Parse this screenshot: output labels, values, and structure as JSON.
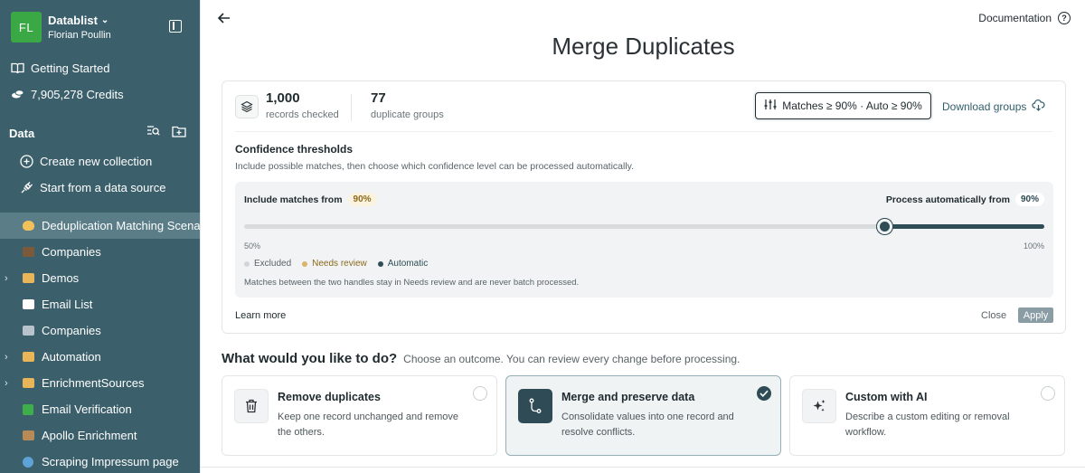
{
  "workspace": {
    "initials": "FL",
    "name": "Datablist",
    "user": "Florian Poullin"
  },
  "sidebar": {
    "getting_started": "Getting Started",
    "credits": "7,905,278 Credits",
    "data_label": "Data",
    "actions": {
      "create": "Create new collection",
      "start": "Start from a data source"
    },
    "collections": [
      {
        "label": "Deduplication Matching Scenarios",
        "icon": "wave-emoji",
        "caret": false,
        "active": true
      },
      {
        "label": "Companies",
        "icon": "briefcase-emoji",
        "caret": false,
        "active": false
      },
      {
        "label": "Demos",
        "icon": "folder-emoji",
        "caret": true,
        "active": false
      },
      {
        "label": "Email List",
        "icon": "email-emoji",
        "caret": false,
        "active": false
      },
      {
        "label": "Companies",
        "icon": "building-emoji",
        "caret": false,
        "active": false
      },
      {
        "label": "Automation",
        "icon": "folder-emoji",
        "caret": true,
        "active": false
      },
      {
        "label": "EnrichmentSources",
        "icon": "folder-emoji",
        "caret": true,
        "active": false
      },
      {
        "label": "Email Verification",
        "icon": "check-emoji",
        "caret": false,
        "active": false
      },
      {
        "label": "Apollo Enrichment",
        "icon": "spy-emoji",
        "caret": false,
        "active": false
      },
      {
        "label": "Scraping Impressum page",
        "icon": "globe-emoji",
        "caret": false,
        "active": false
      }
    ]
  },
  "header": {
    "documentation": "Documentation",
    "title": "Merge Duplicates"
  },
  "stats": {
    "records": {
      "value": "1,000",
      "label": "records checked"
    },
    "groups": {
      "value": "77",
      "label": "duplicate groups"
    }
  },
  "threshold_button": "Matches ≥ 90% · Auto ≥ 90%",
  "download_groups": "Download groups",
  "confidence": {
    "title": "Confidence thresholds",
    "description": "Include possible matches, then choose which confidence level can be processed automatically.",
    "include_label": "Include matches from",
    "include_value": "90%",
    "auto_label": "Process automatically from",
    "auto_value": "90%",
    "range_min": "50%",
    "range_max": "100%",
    "slider": {
      "min": 50,
      "max": 100,
      "include": 90,
      "auto": 90
    },
    "legend": {
      "excluded": "Excluded",
      "review": "Needs review",
      "automatic": "Automatic"
    },
    "note": "Matches between the two handles stay in Needs review and are never batch processed."
  },
  "footer": {
    "learn_more": "Learn more",
    "close": "Close",
    "apply": "Apply"
  },
  "question": {
    "title": "What would you like to do?",
    "subtitle": "Choose an outcome. You can review every change before processing."
  },
  "options": [
    {
      "title": "Remove duplicates",
      "desc": "Keep one record unchanged and remove the others.",
      "icon": "trash-icon",
      "selected": false
    },
    {
      "title": "Merge and preserve data",
      "desc": "Consolidate values into one record and resolve conflicts.",
      "icon": "merge-icon",
      "selected": true
    },
    {
      "title": "Custom with AI",
      "desc": "Describe a custom editing or removal workflow.",
      "icon": "sparkle-icon",
      "selected": false
    }
  ],
  "colors": {
    "sidebar": "#3b5f6b",
    "accent": "#2e4d57",
    "avatar": "#3aa845",
    "review": "#8a6a1c"
  }
}
